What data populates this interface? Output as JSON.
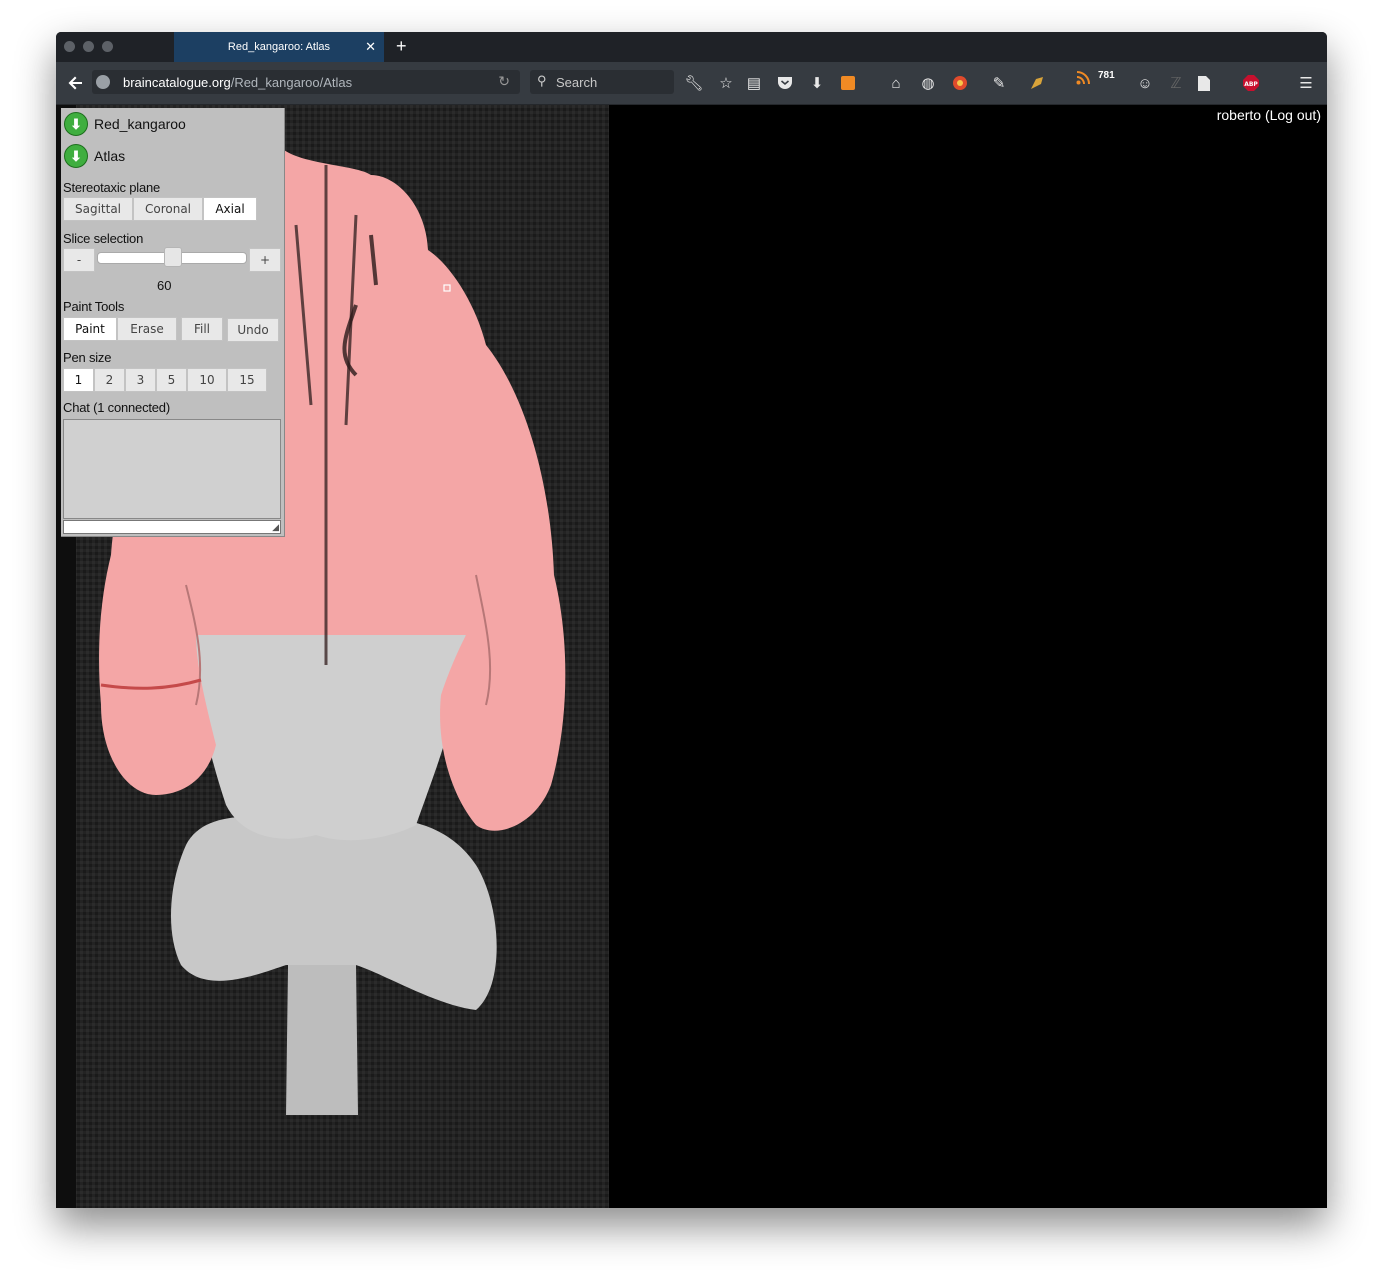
{
  "browser": {
    "tab_title": "Red_kangaroo: Atlas",
    "tab_close": "✕",
    "new_tab": "+",
    "url_host": "braincatalogue.org",
    "url_path": "/Red_kangaroo/Atlas",
    "search_placeholder": "Search",
    "rss_count": "781",
    "toolbar_icons": [
      "wrench-icon",
      "star-icon",
      "reading-list-icon",
      "pocket-icon",
      "download-icon",
      "extension-icon",
      "home-icon",
      "globe-icon",
      "extension-icon",
      "extension-icon",
      "extension-icon",
      "rss-icon",
      "chat-icon",
      "extension-icon",
      "page-icon",
      "adblock-icon",
      "menu-icon"
    ]
  },
  "page": {
    "login_text": "roberto (Log out)"
  },
  "panel": {
    "subject_label": "Red_kangaroo",
    "atlas_label": "Atlas",
    "plane_label": "Stereotaxic plane",
    "planes": [
      "Sagittal",
      "Coronal",
      "Axial"
    ],
    "active_plane": "Axial",
    "slice_label": "Slice selection",
    "slice_minus": "-",
    "slice_plus": "+",
    "slice_value": "60",
    "slice_fraction": 0.51,
    "paint_label": "Paint Tools",
    "tools": [
      "Paint",
      "Erase",
      "Fill",
      "Undo"
    ],
    "active_tool": "Paint",
    "pen_label": "Pen size",
    "pen_sizes": [
      "1",
      "2",
      "3",
      "5",
      "10",
      "15"
    ],
    "active_pen": "1",
    "chat_label": "Chat (1 connected)"
  },
  "colors": {
    "overlay": "#f4a6a6",
    "tab_active": "#1c3f62",
    "navbar": "#363b41",
    "download_icon": "#3fae3f"
  }
}
